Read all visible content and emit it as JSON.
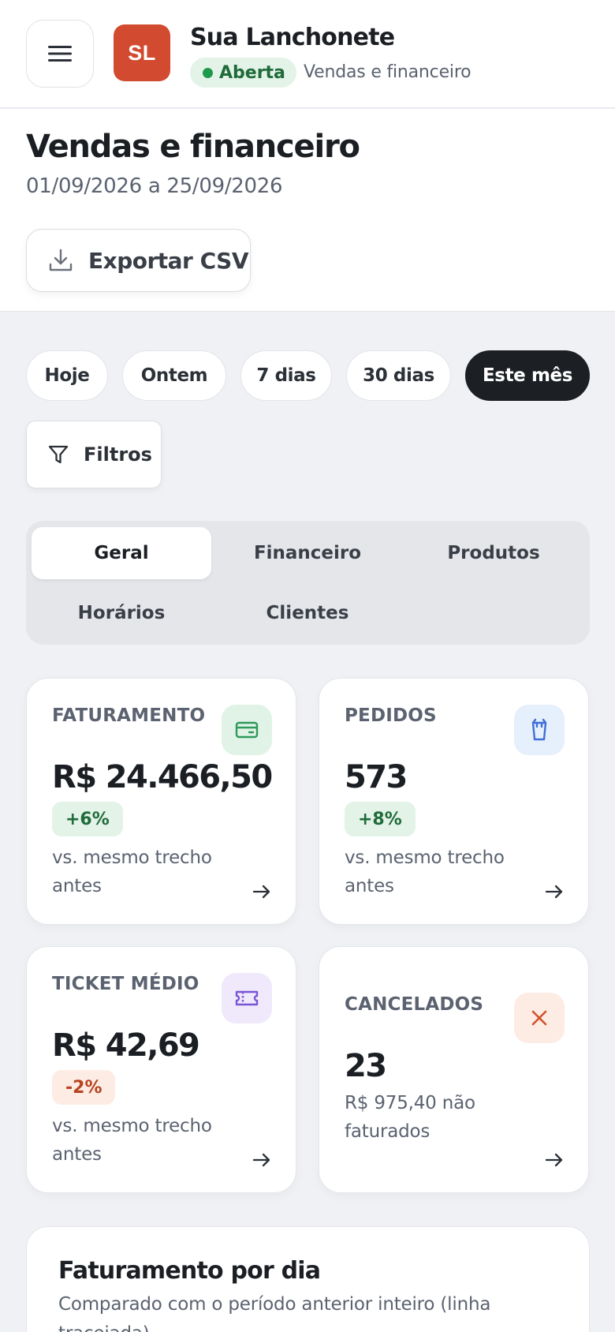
{
  "header": {
    "avatar_initials": "SL",
    "store_name": "Sua Lanchonete",
    "status_label": "Aberta",
    "section": "Vendas e financeiro",
    "avatar_color": "#d24a30",
    "status_color": "#1f9a4d"
  },
  "page": {
    "title": "Vendas e financeiro",
    "date_range": "01/09/2026 a 25/09/2026",
    "export_label": "Exportar CSV"
  },
  "periods": {
    "options": [
      "Hoje",
      "Ontem",
      "7 dias",
      "30 dias",
      "Este mês"
    ],
    "selected": "Este mês",
    "filters_label": "Filtros"
  },
  "tabs": {
    "items": [
      "Geral",
      "Financeiro",
      "Produtos",
      "Horários",
      "Clientes"
    ],
    "selected": "Geral"
  },
  "kpis": [
    {
      "label": "FATURAMENTO",
      "value": "R$ 24.466,50",
      "delta": "+6%",
      "trend": "up",
      "note": "vs. mesmo trecho antes",
      "icon": "card-icon",
      "icon_color": "#2f9a5a"
    },
    {
      "label": "PEDIDOS",
      "value": "573",
      "delta": "+8%",
      "trend": "up",
      "note": "vs. mesmo trecho antes",
      "icon": "bag-icon",
      "icon_color": "#3f6fd8"
    },
    {
      "label": "TICKET MÉDIO",
      "value": "R$ 42,69",
      "delta": "-2%",
      "trend": "down",
      "note": "vs. mesmo trecho antes",
      "icon": "ticket-icon",
      "icon_color": "#7b55d6"
    },
    {
      "label": "CANCELADOS",
      "value": "23",
      "note": "R$ 975,40 não faturados",
      "icon": "x-icon",
      "icon_color": "#d2502c"
    }
  ],
  "revenue_panel": {
    "title": "Faturamento por dia",
    "subtitle": "Comparado com o período anterior inteiro (linha tracejada)"
  }
}
